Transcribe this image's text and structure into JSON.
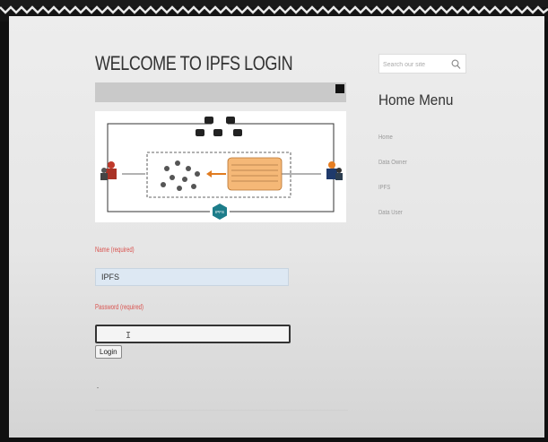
{
  "login": {
    "title": "WELCOME TO IPFS LOGIN",
    "name_label": "Name (required)",
    "name_value": "IPFS",
    "password_label": "Password (required)",
    "password_value": "",
    "login_button": "Login"
  },
  "sidebar": {
    "search_placeholder": "Search our site",
    "menu_title": "Home Menu",
    "items": [
      {
        "label": "Home"
      },
      {
        "label": "Data Owner"
      },
      {
        "label": "IPFS"
      },
      {
        "label": "Data User"
      }
    ]
  },
  "diagram": {
    "hub_label": "IPFS"
  },
  "colors": {
    "label_red": "#d9534f",
    "name_input_bg": "#dde8f3",
    "diagram_orange": "#f5b877",
    "hub_teal": "#1d7d8a"
  }
}
